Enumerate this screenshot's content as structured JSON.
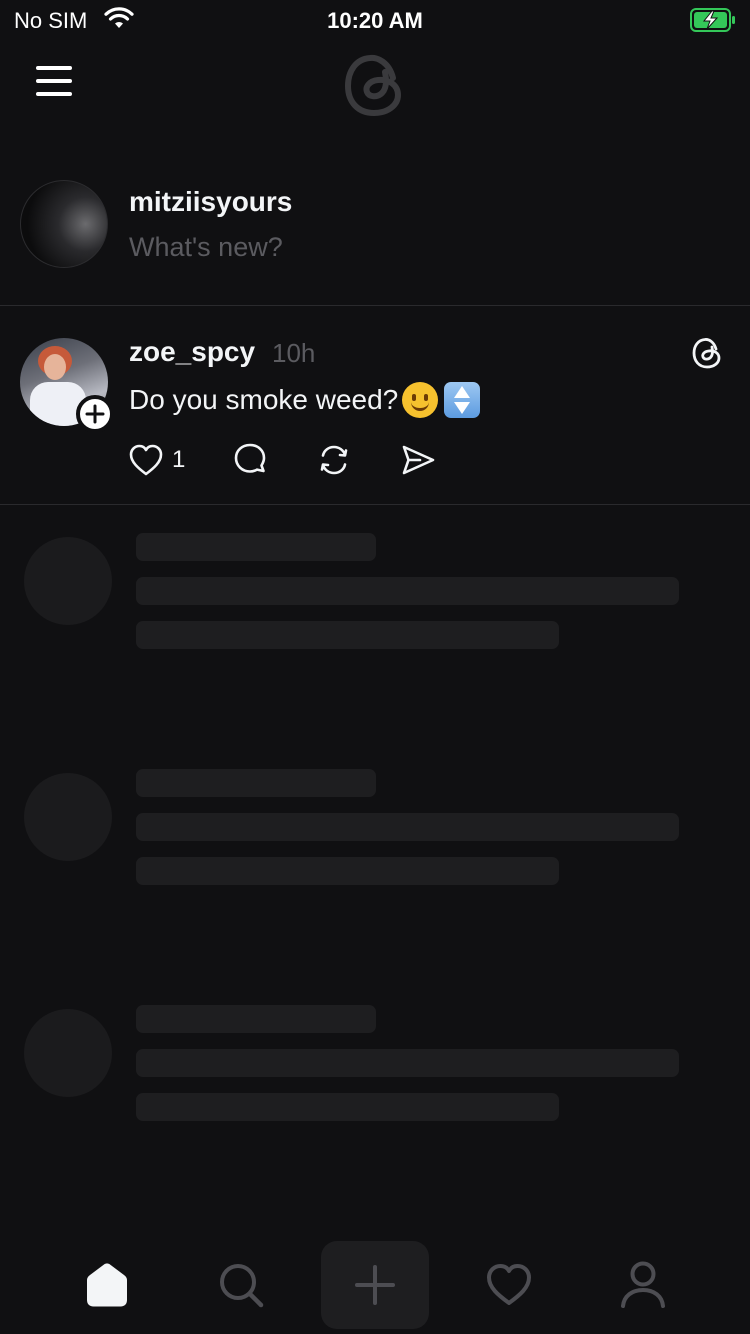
{
  "status_bar": {
    "carrier": "No SIM",
    "time": "10:20 AM",
    "wifi_icon": "wifi-icon",
    "battery_icon": "battery-charging-icon",
    "battery_color": "#34c759"
  },
  "header": {
    "menu_icon": "menu-icon",
    "logo_icon": "threads-logo-icon"
  },
  "composer": {
    "username": "mitziisyours",
    "placeholder": "What's new?"
  },
  "post": {
    "username": "zoe_spcy",
    "time": "10h",
    "text": "Do you smoke weed?",
    "emojis": [
      "slightly-smiling-face",
      "up-down-arrow"
    ],
    "like_count": "1",
    "badge_icon": "threads-icon",
    "follow_icon": "plus-icon",
    "actions": [
      "heart-icon",
      "comment-icon",
      "repost-icon",
      "share-icon"
    ]
  },
  "tab_bar": {
    "tabs": [
      "home-icon",
      "search-icon",
      "create-icon",
      "activity-icon",
      "profile-icon"
    ],
    "active": "home-icon"
  },
  "colors": {
    "background": "#101012",
    "text_primary": "#f3f5f7",
    "text_secondary": "#5b5b60",
    "skeleton": "#1e1e20"
  }
}
